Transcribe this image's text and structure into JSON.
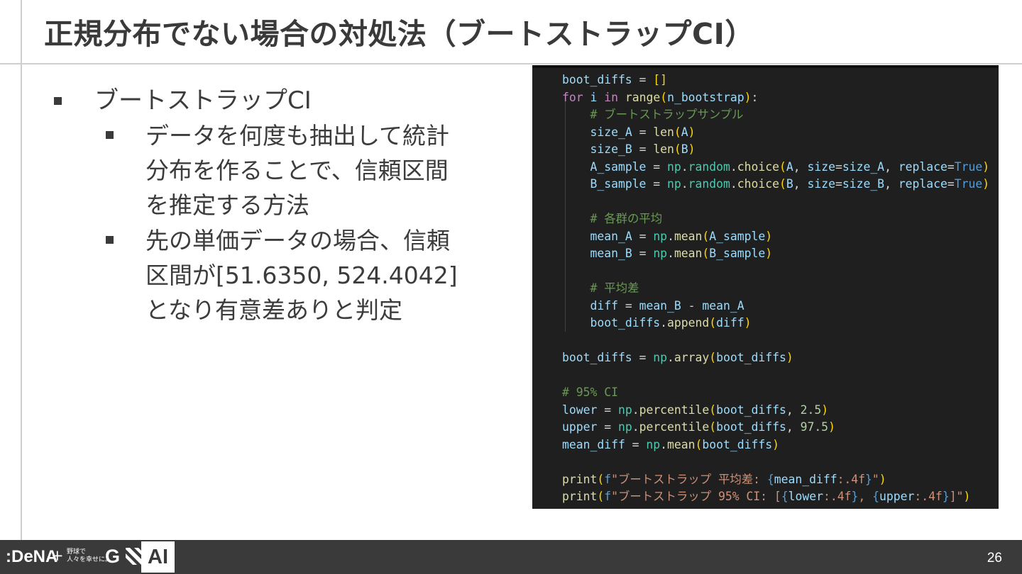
{
  "slide": {
    "title": "正規分布でない場合の対処法（ブートストラップCI）",
    "bullets": {
      "level1": "ブートストラップCI",
      "sub1": [
        "データを何度も抽出して統計",
        "分布を作ることで、信頼区間",
        "を推定する方法"
      ],
      "sub2": [
        "先の単価データの場合、信頼",
        "区間が[51.6350, 524.4042]",
        "となり有意差ありと判定"
      ]
    }
  },
  "code": {
    "lines": [
      "boot_diffs = []",
      "for i in range(n_bootstrap):",
      "    # ブートストラップサンプル",
      "    size_A = len(A)",
      "    size_B = len(B)",
      "    A_sample = np.random.choice(A, size=size_A, replace=True)",
      "    B_sample = np.random.choice(B, size=size_B, replace=True)",
      "",
      "    # 各群の平均",
      "    mean_A = np.mean(A_sample)",
      "    mean_B = np.mean(B_sample)",
      "",
      "    # 平均差",
      "    diff = mean_B - mean_A",
      "    boot_diffs.append(diff)",
      "",
      "boot_diffs = np.array(boot_diffs)",
      "",
      "# 95% CI",
      "lower = np.percentile(boot_diffs, 2.5)",
      "upper = np.percentile(boot_diffs, 97.5)",
      "mean_diff = np.mean(boot_diffs)",
      "",
      "print(f\"ブートストラップ 平均差: {mean_diff:.4f}\")",
      "print(f\"ブートストラップ 95% CI: [{lower:.4f}, {upper:.4f}]\")"
    ]
  },
  "footer": {
    "logo_dena": ":DeNA",
    "logo_plus": "+",
    "logo_jp_line1": "野球で",
    "logo_jp_line2": "人々を幸せに。",
    "logo_g": "G",
    "ai_label": "AI",
    "page_number": "26"
  },
  "colors": {
    "code_background": "#1f1f1f",
    "footer_background": "#3a3a3a",
    "keyword": "#c586c0",
    "function": "#dcdcaa",
    "variable": "#9cdcfe",
    "comment": "#6a9955",
    "string": "#ce9178",
    "number": "#b5cea8",
    "constant": "#569cd6"
  }
}
